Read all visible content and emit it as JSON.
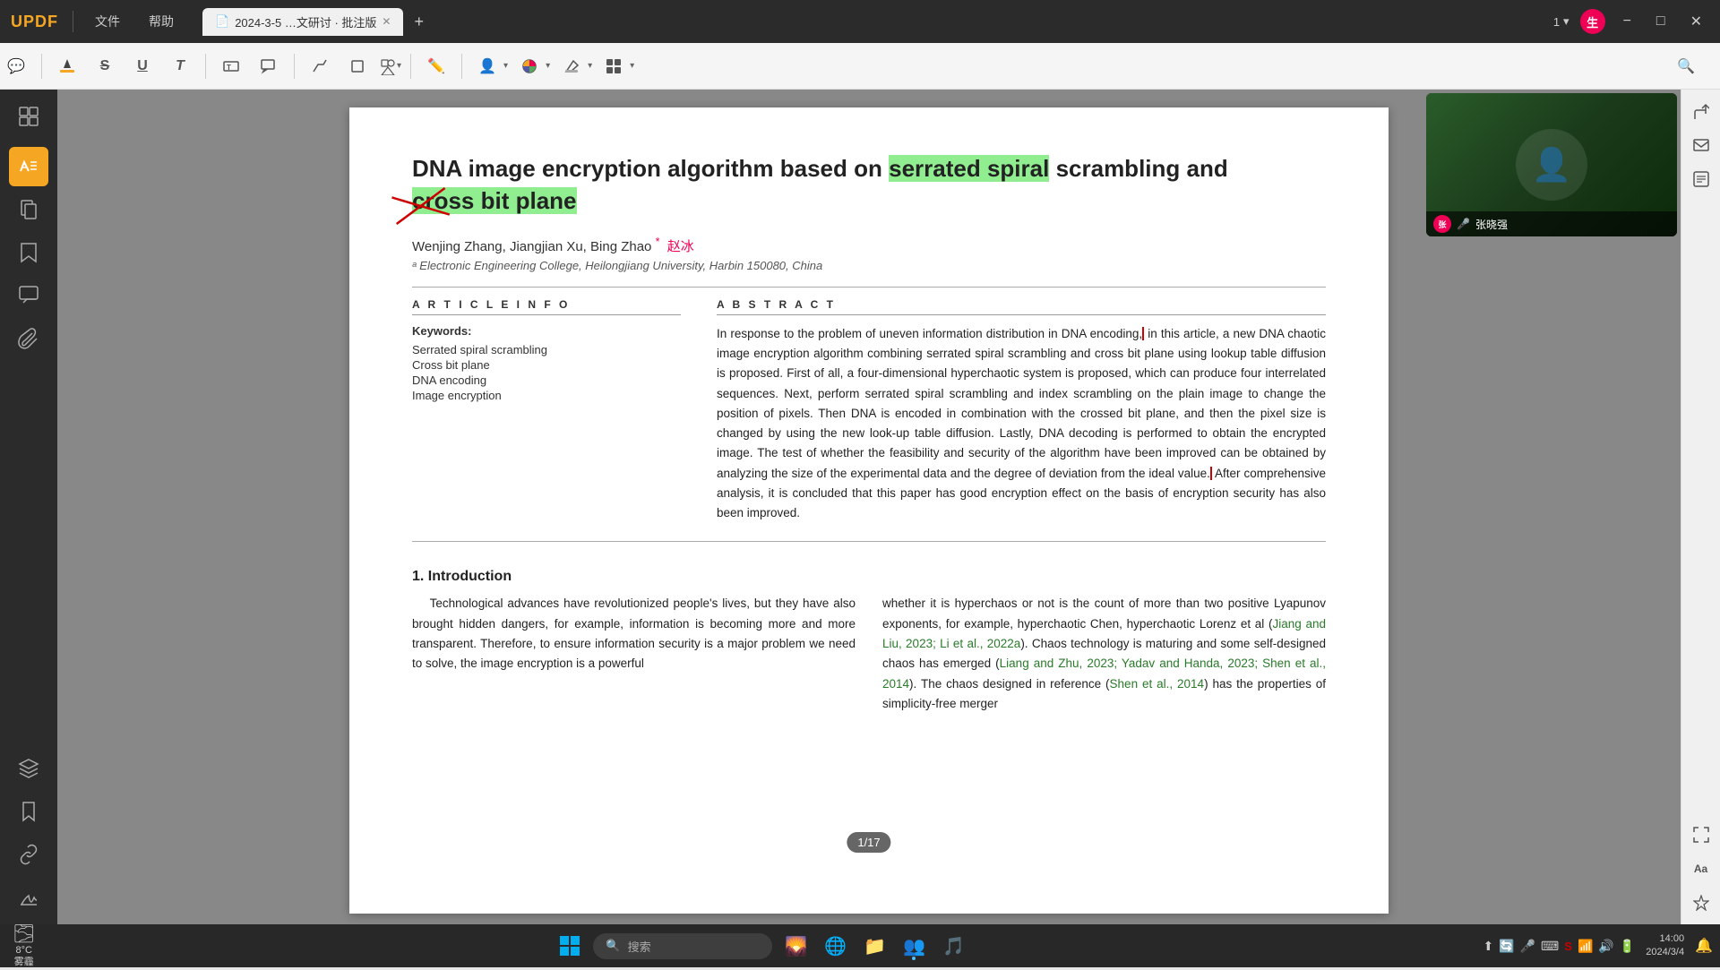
{
  "app": {
    "logo": "UPDF",
    "menus": [
      "文件",
      "帮助"
    ],
    "tab": {
      "label": "2024-3-5 …文研讨 · 批注版",
      "icon": "📄"
    },
    "page_indicator": "1",
    "page_dropdown_icon": "▾",
    "user_avatar": "生",
    "win_min": "−",
    "win_max": "□",
    "win_close": "✕"
  },
  "toolbar": {
    "buttons": [
      {
        "name": "comment",
        "icon": "💬"
      },
      {
        "name": "highlight",
        "icon": "🖊"
      },
      {
        "name": "strikethrough",
        "icon": "S"
      },
      {
        "name": "underline",
        "icon": "U"
      },
      {
        "name": "text-format",
        "icon": "T"
      },
      {
        "name": "text-box",
        "icon": "T"
      },
      {
        "name": "text-align",
        "icon": "≡"
      },
      {
        "name": "text-align2",
        "icon": "☰"
      },
      {
        "name": "draw",
        "icon": "△"
      },
      {
        "name": "shape",
        "icon": "□"
      },
      {
        "name": "shapes-more",
        "icon": "◻"
      },
      {
        "name": "pen",
        "icon": "✏"
      },
      {
        "name": "stamp",
        "icon": "👤"
      },
      {
        "name": "color",
        "icon": "🎨"
      },
      {
        "name": "more",
        "icon": "⊞"
      }
    ],
    "search_icon": "🔍"
  },
  "sidebar": {
    "items": [
      {
        "name": "thumbnails",
        "icon": "⊞"
      },
      {
        "name": "spacer"
      },
      {
        "name": "annotation",
        "icon": "🖊"
      },
      {
        "name": "pages",
        "icon": "📄"
      },
      {
        "name": "bookmarks",
        "icon": "☰"
      },
      {
        "name": "comments",
        "icon": "💬"
      },
      {
        "name": "attach",
        "icon": "📎"
      },
      {
        "name": "spacer2"
      },
      {
        "name": "layers",
        "icon": "⊚"
      },
      {
        "name": "bookmark",
        "icon": "🔖"
      },
      {
        "name": "link",
        "icon": "🔗"
      },
      {
        "name": "sign",
        "icon": "✍"
      }
    ]
  },
  "right_sidebar": {
    "items": [
      {
        "name": "share",
        "icon": "↑"
      },
      {
        "name": "email",
        "icon": "✉"
      },
      {
        "name": "contact",
        "icon": "📋"
      },
      {
        "name": "spacer"
      },
      {
        "name": "fit",
        "icon": "⤢"
      },
      {
        "name": "text-size",
        "icon": "Aa"
      },
      {
        "name": "star",
        "icon": "★"
      }
    ]
  },
  "paper": {
    "title_part1": "DNA image encryption algorithm based on ",
    "title_highlight": "serrated spiral",
    "title_part2": " scrambling and",
    "title_line2": "cross bit plane",
    "authors": "Wenjing Zhang, Jiangjian Xu, Bing Zhao",
    "author_extra": "赵冰",
    "affiliation": "ᵃ Electronic Engineering College, Heilongjiang University, Harbin 150080, China",
    "article_info_label": "A R T I C L E  I N F O",
    "abstract_label": "A B S T R A C T",
    "keywords_label": "Keywords:",
    "keywords": [
      "Serrated spiral scrambling",
      "Cross bit plane",
      "DNA encoding",
      "Image encryption"
    ],
    "abstract": "In response to the problem of uneven information distribution in DNA encoding, in this article, a new DNA chaotic image encryption algorithm combining serrated spiral scrambling and cross bit plane using lookup table diffusion is proposed. First of all, a four-dimensional hyperchaotic system is proposed, which can produce four interrelated sequences. Next, perform serrated spiral scrambling and index scrambling on the plain image to change the position of pixels. Then DNA is encoded in combination with the crossed bit plane, and then the pixel size is changed by using the new look-up table diffusion. Lastly, DNA decoding is performed to obtain the encrypted image. The test of whether the feasibility and security of the algorithm have been improved can be obtained by analyzing the size of the experimental data and the degree of deviation from the ideal value. After comprehensive analysis, it is concluded that this paper has good encryption effect on the basis of encryption security has also been improved.",
    "intro_heading": "1.  Introduction",
    "intro_col1": "Technological advances have revolutionized people's lives, but they have also brought hidden dangers, for example, information is becoming more and more transparent. Therefore, to ensure information security is a major problem we need to solve, the image encryption is a powerful",
    "intro_col2": "whether it is hyperchaos or not is the count of more than two positive Lyapunov exponents, for example, hyperchaotic Chen, hyperchaotic Lorenz et al (Jiang and Liu, 2023; Li et al., 2022a). Chaos technology is maturing and some self-designed chaos has emerged (Liang and Zhu, 2023; Yadav and Handa, 2023; Shen et al., 2014). The chaos designed in reference (Shen et al., 2014) has the properties of simplicity-free merger"
  },
  "video": {
    "name": "张晓强",
    "avatar_text": "张",
    "mic_icon": "🎤"
  },
  "page_badge": "1/17",
  "taskbar": {
    "weather_icon": "🌫",
    "weather_temp": "8°C",
    "weather_desc": "雾霾",
    "start_icon": "⊞",
    "search_placeholder": "搜索",
    "search_icon": "🔍",
    "apps": [
      {
        "name": "explorer",
        "icon": "🌄",
        "active": false
      },
      {
        "name": "edge",
        "icon": "🌐",
        "active": false
      },
      {
        "name": "files",
        "icon": "📁",
        "active": false
      },
      {
        "name": "teams",
        "icon": "👥",
        "active": false
      },
      {
        "name": "app5",
        "icon": "🎵",
        "active": false
      }
    ],
    "tray_icons": [
      "⬆",
      "🔄",
      "🎤",
      "⌨",
      "🅂",
      "📶",
      "🔊",
      "🔋"
    ],
    "clock_time": "14:00",
    "clock_date": "2024/3/4",
    "notification_icon": "🔔"
  }
}
